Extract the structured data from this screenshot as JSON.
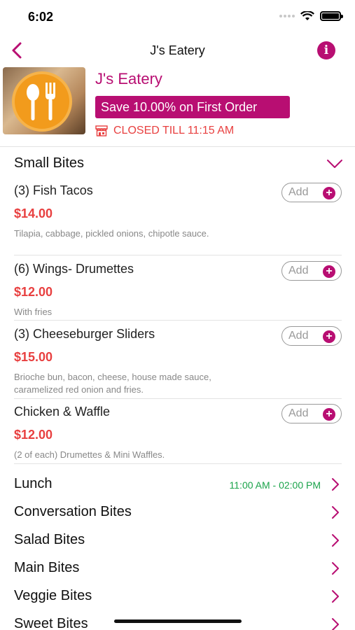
{
  "status_bar": {
    "time": "6:02"
  },
  "nav": {
    "title": "J's Eatery"
  },
  "restaurant": {
    "name": "J's Eatery",
    "promo": "Save 10.00% on First Order",
    "status": "CLOSED TILL 11:15 AM"
  },
  "section": {
    "title": "Small Bites"
  },
  "items": [
    {
      "name": "(3) Fish Tacos",
      "price": "$14.00",
      "description": "Tilapia, cabbage, pickled onions, chipotle sauce.",
      "add_label": "Add"
    },
    {
      "name": "(6) Wings- Drumettes",
      "price": "$12.00",
      "description": "With fries",
      "add_label": "Add"
    },
    {
      "name": "(3) Cheeseburger Sliders",
      "price": "$15.00",
      "description": "Brioche bun, bacon, cheese, house made sauce, caramelized red onion and fries.",
      "add_label": "Add"
    },
    {
      "name": "Chicken & Waffle",
      "price": "$12.00",
      "description": "(2 of each) Drumettes & Mini Waffles.",
      "add_label": "Add"
    }
  ],
  "categories": [
    {
      "label": "Lunch",
      "time": "11:00 AM - 02:00 PM"
    },
    {
      "label": "Conversation Bites"
    },
    {
      "label": "Salad Bites"
    },
    {
      "label": "Main Bites"
    },
    {
      "label": "Veggie Bites"
    },
    {
      "label": "Sweet Bites"
    }
  ],
  "colors": {
    "accent": "#b80e72",
    "price": "#e84040",
    "time": "#1aa34a"
  },
  "icons": [
    "back-chevron-icon",
    "info-icon",
    "store-icon",
    "chevron-down-icon",
    "plus-icon",
    "chevron-right-icon",
    "restaurant-logo"
  ]
}
